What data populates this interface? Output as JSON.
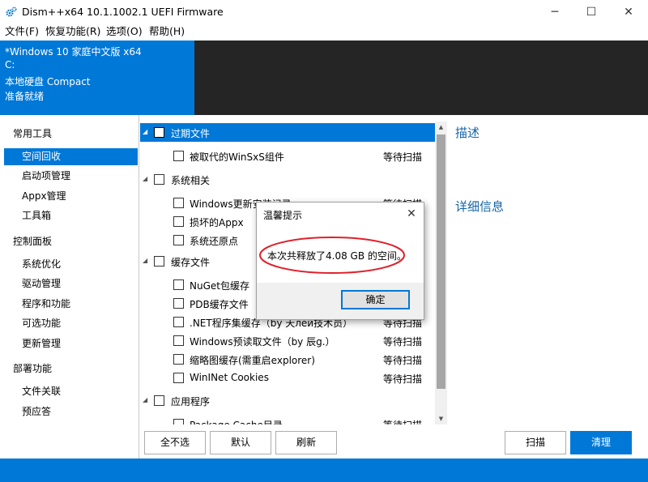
{
  "window": {
    "title": "Dism++x64 10.1.1002.1 UEFI Firmware",
    "controls": {
      "minimize": "─",
      "maximize": "☐",
      "close": "✕"
    }
  },
  "menu": [
    {
      "label": "文件(F)"
    },
    {
      "label": "恢复功能(R)"
    },
    {
      "label": "选项(O)"
    },
    {
      "label": "帮助(H)"
    }
  ],
  "info": {
    "lines": [
      "*Windows 10 家庭中文版 x64",
      "C:",
      "本地硬盘 Compact",
      "准备就绪"
    ]
  },
  "sidebar": {
    "groups": [
      {
        "label": "常用工具",
        "items": [
          {
            "label": "空间回收",
            "selected": true
          },
          {
            "label": "启动项管理"
          },
          {
            "label": "Appx管理"
          },
          {
            "label": "工具箱"
          }
        ]
      },
      {
        "label": "控制面板",
        "items": [
          {
            "label": "系统优化"
          },
          {
            "label": "驱动管理"
          },
          {
            "label": "程序和功能"
          },
          {
            "label": "可选功能"
          },
          {
            "label": "更新管理"
          }
        ]
      },
      {
        "label": "部署功能",
        "items": [
          {
            "label": "文件关联"
          },
          {
            "label": "预应答"
          }
        ]
      }
    ]
  },
  "list": {
    "rows": [
      {
        "type": "group",
        "label": "过期文件",
        "selected": true
      },
      {
        "type": "item",
        "label": "被取代的WinSxS组件",
        "status": "等待扫描"
      },
      {
        "type": "group",
        "label": "系统相关"
      },
      {
        "type": "item",
        "label": "Windows更新安装记录",
        "status": "等待扫描"
      },
      {
        "type": "item",
        "label": "损坏的Appx",
        "status": ""
      },
      {
        "type": "item",
        "label": "系统还原点",
        "status": ""
      },
      {
        "type": "group",
        "label": "缓存文件"
      },
      {
        "type": "item",
        "label": "NuGet包缓存",
        "status": ""
      },
      {
        "type": "item",
        "label": "PDB缓存文件",
        "status": ""
      },
      {
        "type": "item",
        "label": ".NET程序集缓存（by 天лей技术员）",
        "status": "等待扫描"
      },
      {
        "type": "item",
        "label": "Windows预读取文件（by 辰g.）",
        "status": "等待扫描"
      },
      {
        "type": "item",
        "label": "缩略图缓存(需重启explorer)",
        "status": "等待扫描"
      },
      {
        "type": "item",
        "label": "WinINet Cookies",
        "status": "等待扫描"
      },
      {
        "type": "group",
        "label": "应用程序"
      },
      {
        "type": "item",
        "label": "Package Cache目录",
        "status": "等待扫描"
      }
    ]
  },
  "details": {
    "description_title": "描述",
    "detail_title": "详细信息"
  },
  "buttons": {
    "deselect_all": "全不选",
    "default": "默认",
    "refresh": "刷新",
    "scan": "扫描",
    "clean": "清理"
  },
  "dialog": {
    "title": "温馨提示",
    "message": "本次共释放了4.08 GB 的空间。",
    "ok": "确定",
    "close": "✕"
  },
  "colors": {
    "accent": "#0078d7",
    "dark_panel": "#252526",
    "annotation_red": "#e0202a",
    "link_blue": "#1664a8"
  }
}
